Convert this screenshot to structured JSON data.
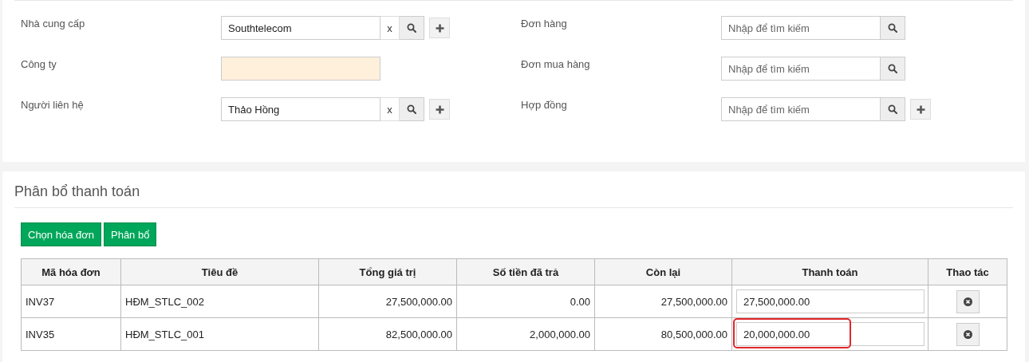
{
  "filters": {
    "left": [
      {
        "kind": "lookup",
        "label": "Nhà cung cấp",
        "value": "Southtelecom",
        "clear": "x",
        "addable": true
      },
      {
        "kind": "readonly",
        "label": "Công ty"
      },
      {
        "kind": "lookup",
        "label": "Người liên hệ",
        "value": "Thảo Hồng",
        "clear": "x",
        "addable": true
      }
    ],
    "right": [
      {
        "kind": "lookup",
        "label": "Đơn hàng",
        "placeholder": "Nhập để tìm kiếm",
        "addable": false
      },
      {
        "kind": "lookup",
        "label": "Đơn mua hàng",
        "placeholder": "Nhập để tìm kiếm",
        "addable": false
      },
      {
        "kind": "lookup",
        "label": "Hợp đồng",
        "placeholder": "Nhập để tìm kiếm",
        "addable": true
      }
    ]
  },
  "allocation": {
    "title": "Phân bổ thanh toán",
    "buttons": [
      "Chọn hóa đơn",
      "Phân bổ"
    ],
    "table": {
      "columns": [
        "Mã hóa đơn",
        "Tiêu đề",
        "Tổng giá trị",
        "Số tiền đã trả",
        "Còn lại",
        "Thanh toán",
        "Thao tác"
      ],
      "rows": [
        {
          "invoice": "INV37",
          "title": "HĐM_STLC_002",
          "total": "27,500,000.00",
          "paid": "0.00",
          "remaining": "27,500,000.00",
          "payment": "27,500,000.00",
          "highlighted": false
        },
        {
          "invoice": "INV35",
          "title": "HĐM_STLC_001",
          "total": "82,500,000.00",
          "paid": "2,000,000.00",
          "remaining": "80,500,000.00",
          "payment": "20,000,000.00",
          "highlighted": true
        }
      ]
    }
  }
}
